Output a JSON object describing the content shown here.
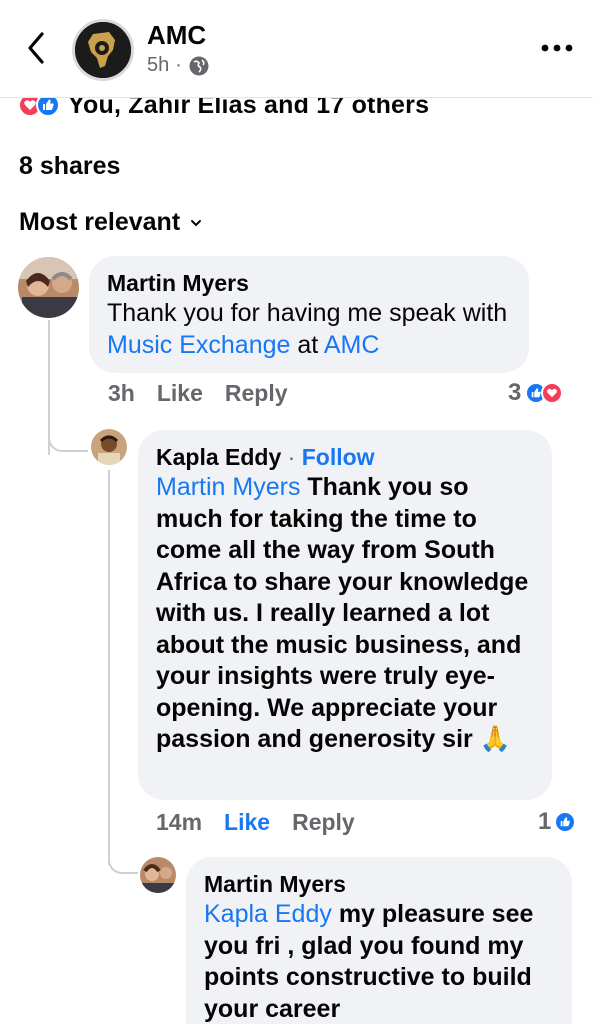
{
  "header": {
    "page_name": "AMC",
    "time": "5h",
    "separator": "·",
    "icons": {
      "back": "chevron-left-icon",
      "privacy": "globe-icon",
      "more": "more-horizontal-icon"
    }
  },
  "reactions": {
    "summary": "You, Zahir Elias and 17 others",
    "types": [
      "love",
      "like"
    ]
  },
  "shares": "8 shares",
  "sort": {
    "label": "Most relevant"
  },
  "comments": [
    {
      "author": "Martin Myers",
      "text_before": "Thank you for having me speak with ",
      "mention1": "Music Exchange",
      "text_mid": " at ",
      "mention2": "AMC",
      "time": "3h",
      "like_label": "Like",
      "reply_label": "Reply",
      "reaction_count": "3"
    },
    {
      "author": "Kapla Eddy",
      "follow_label": "Follow",
      "mention": "Martin Myers",
      "text": " Thank you so much for taking the time to come all the way from South Africa to share your knowledge with us. I really learned a lot about the music business, and your insights were truly eye-opening. We appreciate your passion and generosity sir ",
      "emoji": "🙏",
      "time": "14m",
      "like_label": "Like",
      "reply_label": "Reply",
      "reaction_count": "1"
    },
    {
      "author": "Martin Myers",
      "mention": "Kapla Eddy",
      "text": " my pleasure see you fri , glad you found my points constructive to build your career"
    }
  ],
  "colors": {
    "accent": "#1877f2",
    "love": "#f33e58",
    "bubble": "#f0f2f5",
    "secondary_text": "#65676b"
  }
}
